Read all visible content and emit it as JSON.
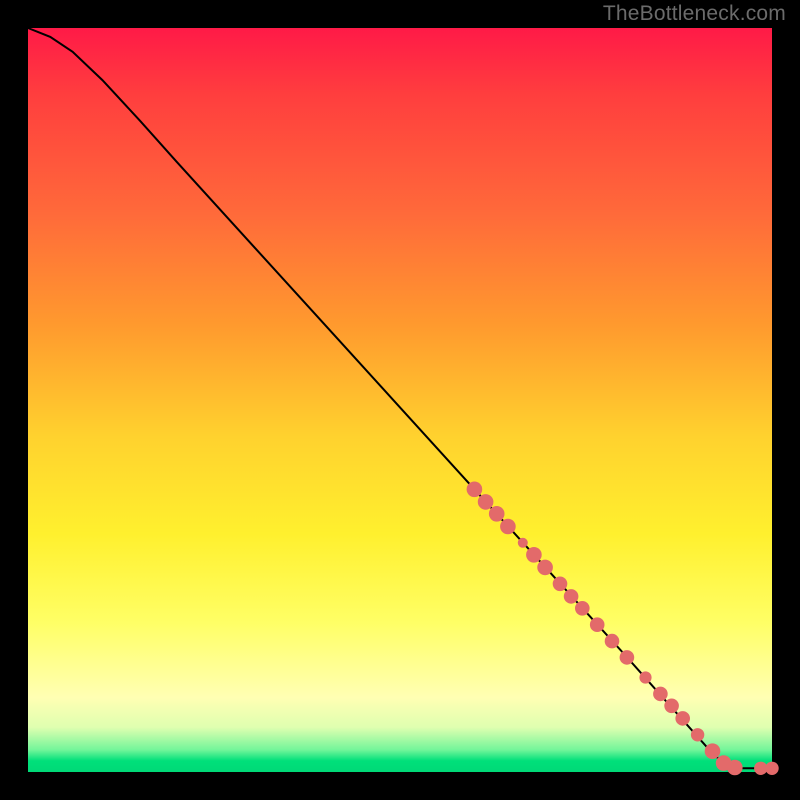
{
  "watermark": "TheBottleneck.com",
  "colors": {
    "marker": "#e36a6a",
    "curve": "#000000",
    "background_black": "#000000"
  },
  "chart_data": {
    "type": "line",
    "title": "",
    "xlabel": "",
    "ylabel": "",
    "xlim": [
      0,
      100
    ],
    "ylim": [
      0,
      100
    ],
    "grid": false,
    "curve": {
      "comment": "Monotone decreasing curve; x in 0..100, y in 0..100. Upper-left has slight convex bulge, rest near-linear to bottom-right, then flat at y≈0 for x≥~94.",
      "points": [
        {
          "x": 0.0,
          "y": 100.0
        },
        {
          "x": 3.0,
          "y": 98.8
        },
        {
          "x": 6.0,
          "y": 96.8
        },
        {
          "x": 10.0,
          "y": 93.0
        },
        {
          "x": 15.0,
          "y": 87.6
        },
        {
          "x": 20.0,
          "y": 82.0
        },
        {
          "x": 30.0,
          "y": 71.0
        },
        {
          "x": 40.0,
          "y": 60.0
        },
        {
          "x": 50.0,
          "y": 49.0
        },
        {
          "x": 60.0,
          "y": 38.0
        },
        {
          "x": 70.0,
          "y": 27.0
        },
        {
          "x": 80.0,
          "y": 16.0
        },
        {
          "x": 88.0,
          "y": 7.0
        },
        {
          "x": 92.0,
          "y": 2.5
        },
        {
          "x": 94.0,
          "y": 0.8
        },
        {
          "x": 96.0,
          "y": 0.5
        },
        {
          "x": 100.0,
          "y": 0.5
        }
      ]
    },
    "markers": {
      "comment": "Clustered salmon-colored markers along the lower diagonal and bottom-right; each entry is x,y,r where r is visual radius in plot units.",
      "points": [
        {
          "x": 60.0,
          "y": 38.0,
          "r": 1.4
        },
        {
          "x": 61.5,
          "y": 36.3,
          "r": 1.4
        },
        {
          "x": 63.0,
          "y": 34.7,
          "r": 1.4
        },
        {
          "x": 64.5,
          "y": 33.0,
          "r": 1.4
        },
        {
          "x": 66.5,
          "y": 30.8,
          "r": 0.9
        },
        {
          "x": 68.0,
          "y": 29.2,
          "r": 1.4
        },
        {
          "x": 69.5,
          "y": 27.5,
          "r": 1.4
        },
        {
          "x": 71.5,
          "y": 25.3,
          "r": 1.3
        },
        {
          "x": 73.0,
          "y": 23.6,
          "r": 1.3
        },
        {
          "x": 74.5,
          "y": 22.0,
          "r": 1.3
        },
        {
          "x": 76.5,
          "y": 19.8,
          "r": 1.3
        },
        {
          "x": 78.5,
          "y": 17.6,
          "r": 1.3
        },
        {
          "x": 80.5,
          "y": 15.4,
          "r": 1.3
        },
        {
          "x": 83.0,
          "y": 12.7,
          "r": 1.1
        },
        {
          "x": 85.0,
          "y": 10.5,
          "r": 1.3
        },
        {
          "x": 86.5,
          "y": 8.9,
          "r": 1.3
        },
        {
          "x": 88.0,
          "y": 7.2,
          "r": 1.3
        },
        {
          "x": 90.0,
          "y": 5.0,
          "r": 1.2
        },
        {
          "x": 92.0,
          "y": 2.8,
          "r": 1.4
        },
        {
          "x": 93.5,
          "y": 1.2,
          "r": 1.4
        },
        {
          "x": 95.0,
          "y": 0.6,
          "r": 1.4
        },
        {
          "x": 98.5,
          "y": 0.5,
          "r": 1.2
        },
        {
          "x": 100.0,
          "y": 0.5,
          "r": 1.2
        }
      ]
    }
  }
}
